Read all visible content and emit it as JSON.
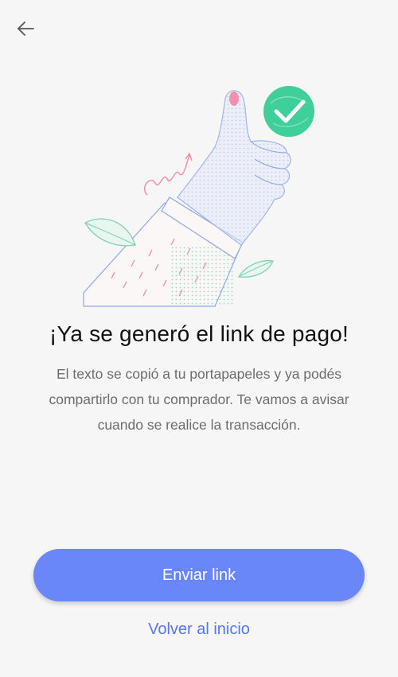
{
  "navigation": {
    "back_icon": "arrow-left-icon"
  },
  "illustration": {
    "icons": [
      "thumbs-up-hand-illustration",
      "check-circle-icon",
      "leaf-icon",
      "squiggle-arrow-icon"
    ],
    "colors": {
      "check_circle": "#3ecf9a",
      "hand": "#d6dcf7",
      "nail": "#f48fb1",
      "leaf": "#a8dfc5"
    }
  },
  "content": {
    "title": "¡Ya se generó el link de pago!",
    "description": "El texto se copió a tu portapapeles y ya podés compartirlo con tu comprador. Te vamos a avisar cuando se realice la transacción."
  },
  "actions": {
    "primary_label": "Enviar link",
    "secondary_label": "Volver al inicio"
  },
  "colors": {
    "background": "#f6f6f6",
    "primary_button": "#6a87f9",
    "link": "#5677ee",
    "title": "#111111",
    "body_text": "#6d6d6d"
  }
}
